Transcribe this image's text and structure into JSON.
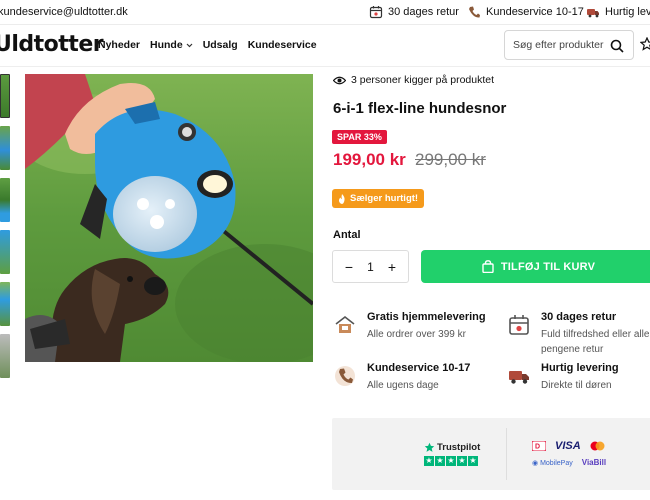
{
  "topbar": {
    "email": "kundeservice@uldtotter.dk",
    "usps": [
      {
        "label": "30 dages retur",
        "icon": "calendar-return-icon"
      },
      {
        "label": "Kundeservice 10-17",
        "icon": "phone-support-icon"
      },
      {
        "label": "Hurtig levering",
        "icon": "delivery-truck-icon"
      }
    ]
  },
  "header": {
    "logo": "Uldtotter",
    "nav": [
      {
        "label": "Nyheder"
      },
      {
        "label": "Hunde",
        "has_dropdown": true
      },
      {
        "label": "Udsalg"
      },
      {
        "label": "Kundeservice"
      }
    ],
    "search_placeholder": "Søg efter produkter"
  },
  "product": {
    "viewers": "3 personer kigger på produktet",
    "title": "6-i-1 flex-line hundesnor",
    "save_badge": "SPAR 33%",
    "price": "199,00 kr",
    "old_price": "299,00 kr",
    "hot_badge": "Sælger hurtigt!",
    "quantity_label": "Antal",
    "quantity": "1",
    "add_to_cart": "TILFØJ TIL KURV"
  },
  "features": [
    {
      "title": "Gratis hjemmelevering",
      "subtitle": "Alle ordrer over 399 kr",
      "icon": "home-delivery-icon"
    },
    {
      "title": "30 dages retur",
      "subtitle": "Fuld tilfredshed eller alle pengene retur",
      "icon": "calendar-return-icon"
    },
    {
      "title": "Kundeservice 10-17",
      "subtitle": "Alle ugens dage",
      "icon": "phone-support-icon"
    },
    {
      "title": "Hurtig levering",
      "subtitle": "Direkte til døren",
      "icon": "delivery-truck-icon"
    }
  ],
  "trust": {
    "trustpilot": "Trustpilot",
    "payments": [
      "Dankort",
      "VISA",
      "Mastercard",
      "MobilePay",
      "ViaBill"
    ]
  },
  "colors": {
    "accent_red": "#e3173d",
    "cart_green": "#21d06b",
    "hot_orange": "#f59a1b",
    "trustpilot_green": "#00b67a"
  }
}
